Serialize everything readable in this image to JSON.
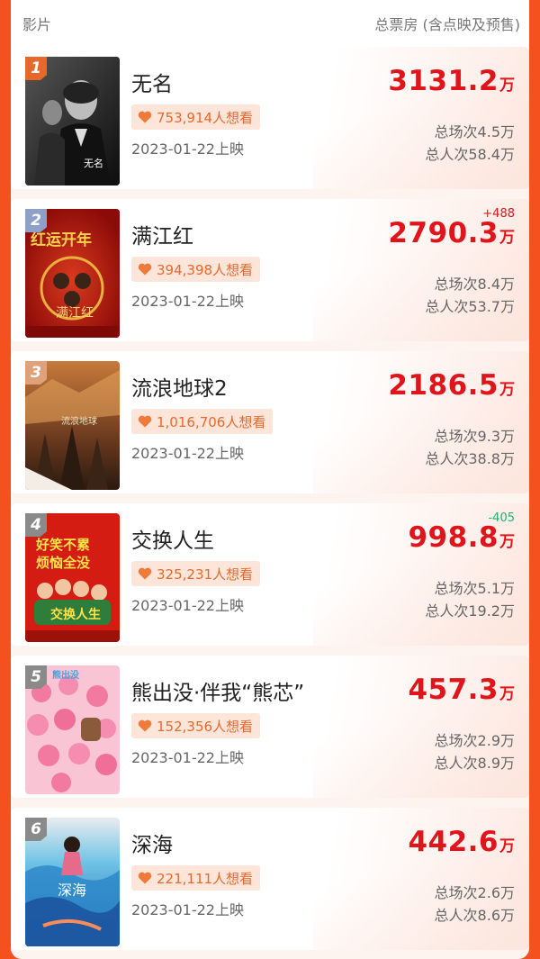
{
  "header": {
    "left": "影片",
    "right": "总票房 (含点映及预售)"
  },
  "colors": {
    "accent": "#e0141b",
    "frame": "#f4511e",
    "want_text": "#e8692c",
    "up": "#e0141b",
    "down": "#22b06b"
  },
  "movies": [
    {
      "rank": "1",
      "title": "无名",
      "want": "753,914人想看",
      "date": "2023-01-22上映",
      "delta": "",
      "box_num": "3131.2",
      "box_unit": "万",
      "shows": "总场次4.5万",
      "people": "总人次58.4万",
      "rank_color": "#e8672a",
      "poster_icon": "poster-noir"
    },
    {
      "rank": "2",
      "title": "满江红",
      "want": "394,398人想看",
      "date": "2023-01-22上映",
      "delta": "+488",
      "box_num": "2790.3",
      "box_unit": "万",
      "shows": "总场次8.4万",
      "people": "总人次53.7万",
      "rank_color": "#8ea0c8",
      "poster_icon": "poster-red"
    },
    {
      "rank": "3",
      "title": "流浪地球2",
      "want": "1,016,706人想看",
      "date": "2023-01-22上映",
      "delta": "",
      "box_num": "2186.5",
      "box_unit": "万",
      "shows": "总场次9.3万",
      "people": "总人次38.8万",
      "rank_color": "#e0a07a",
      "poster_icon": "poster-scifi"
    },
    {
      "rank": "4",
      "title": "交换人生",
      "want": "325,231人想看",
      "date": "2023-01-22上映",
      "delta": "-405",
      "box_num": "998.8",
      "box_unit": "万",
      "shows": "总场次5.1万",
      "people": "总人次19.2万",
      "rank_color": "#8a8a8a",
      "poster_icon": "poster-comedy"
    },
    {
      "rank": "5",
      "title": "熊出没·伴我“熊芯”",
      "want": "152,356人想看",
      "date": "2023-01-22上映",
      "delta": "",
      "box_num": "457.3",
      "box_unit": "万",
      "shows": "总场次2.9万",
      "people": "总人次8.9万",
      "rank_color": "#8a8a8a",
      "poster_icon": "poster-pink"
    },
    {
      "rank": "6",
      "title": "深海",
      "want": "221,111人想看",
      "date": "2023-01-22上映",
      "delta": "",
      "box_num": "442.6",
      "box_unit": "万",
      "shows": "总场次2.6万",
      "people": "总人次8.6万",
      "rank_color": "#8a8a8a",
      "poster_icon": "poster-sea"
    }
  ]
}
